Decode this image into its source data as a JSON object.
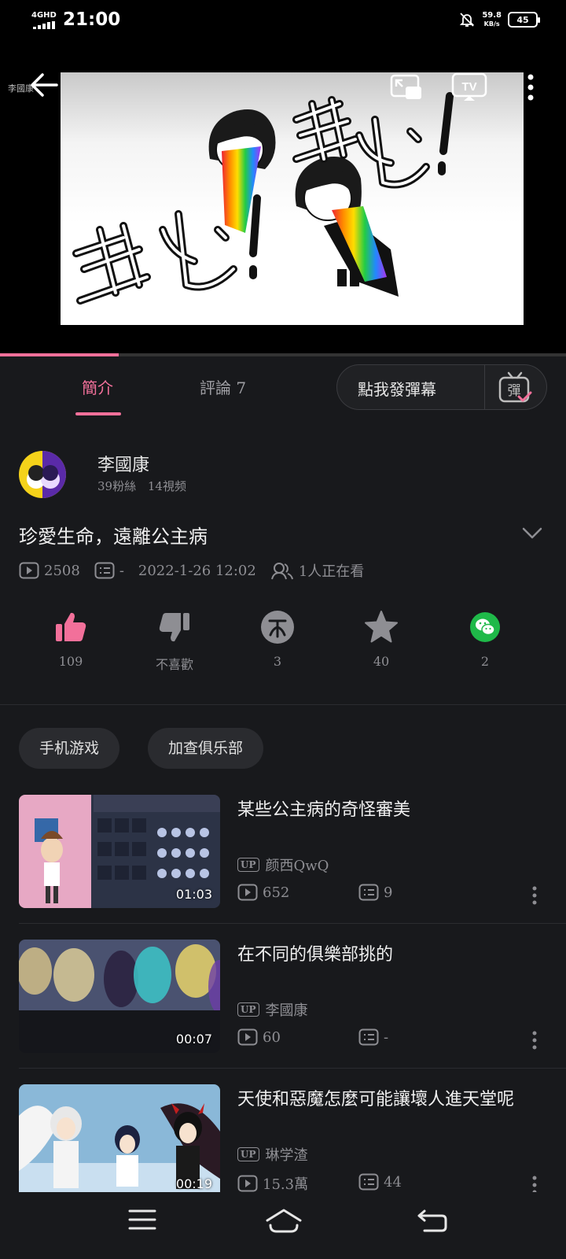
{
  "status_bar": {
    "network": "4GHD",
    "time": "21:00",
    "speed_value": "59.8",
    "speed_unit": "KB/s",
    "battery": "45"
  },
  "player": {
    "watermark": "李國康",
    "progress": 0.21
  },
  "tabs": {
    "intro": "簡介",
    "comments": "評論 7",
    "danmaku_placeholder": "點我發彈幕",
    "danmaku_icon_char": "彈"
  },
  "author": {
    "name": "李國康",
    "followers": "39粉絲",
    "videos": "14視频"
  },
  "video": {
    "title": "珍愛生命，遠離公主病",
    "views": "2508",
    "danmaku_count": "-",
    "date": "2022-1-26 12:02",
    "watching": "1人正在看"
  },
  "actions": {
    "like": "109",
    "dislike": "不喜歡",
    "coin": "3",
    "favorite": "40",
    "share": "2"
  },
  "tags": [
    "手机游戏",
    "加查俱乐部"
  ],
  "recommendations": [
    {
      "title": "某些公主病的奇怪審美",
      "up": "颜西QwQ",
      "views": "652",
      "danmaku": "9",
      "duration": "01:03"
    },
    {
      "title": "在不同的俱樂部挑的",
      "up": "李國康",
      "views": "60",
      "danmaku": "-",
      "duration": "00:07"
    },
    {
      "title": "天使和惡魔怎麼可能讓壞人進天堂呢",
      "up": "琳学渣",
      "views": "15.3萬",
      "danmaku": "44",
      "duration": "00:19"
    }
  ],
  "labels": {
    "up_badge": "UP"
  },
  "colors": {
    "accent": "#f2709a",
    "background": "#18191c",
    "like": "#f2709a",
    "wechat": "#1fb949"
  }
}
